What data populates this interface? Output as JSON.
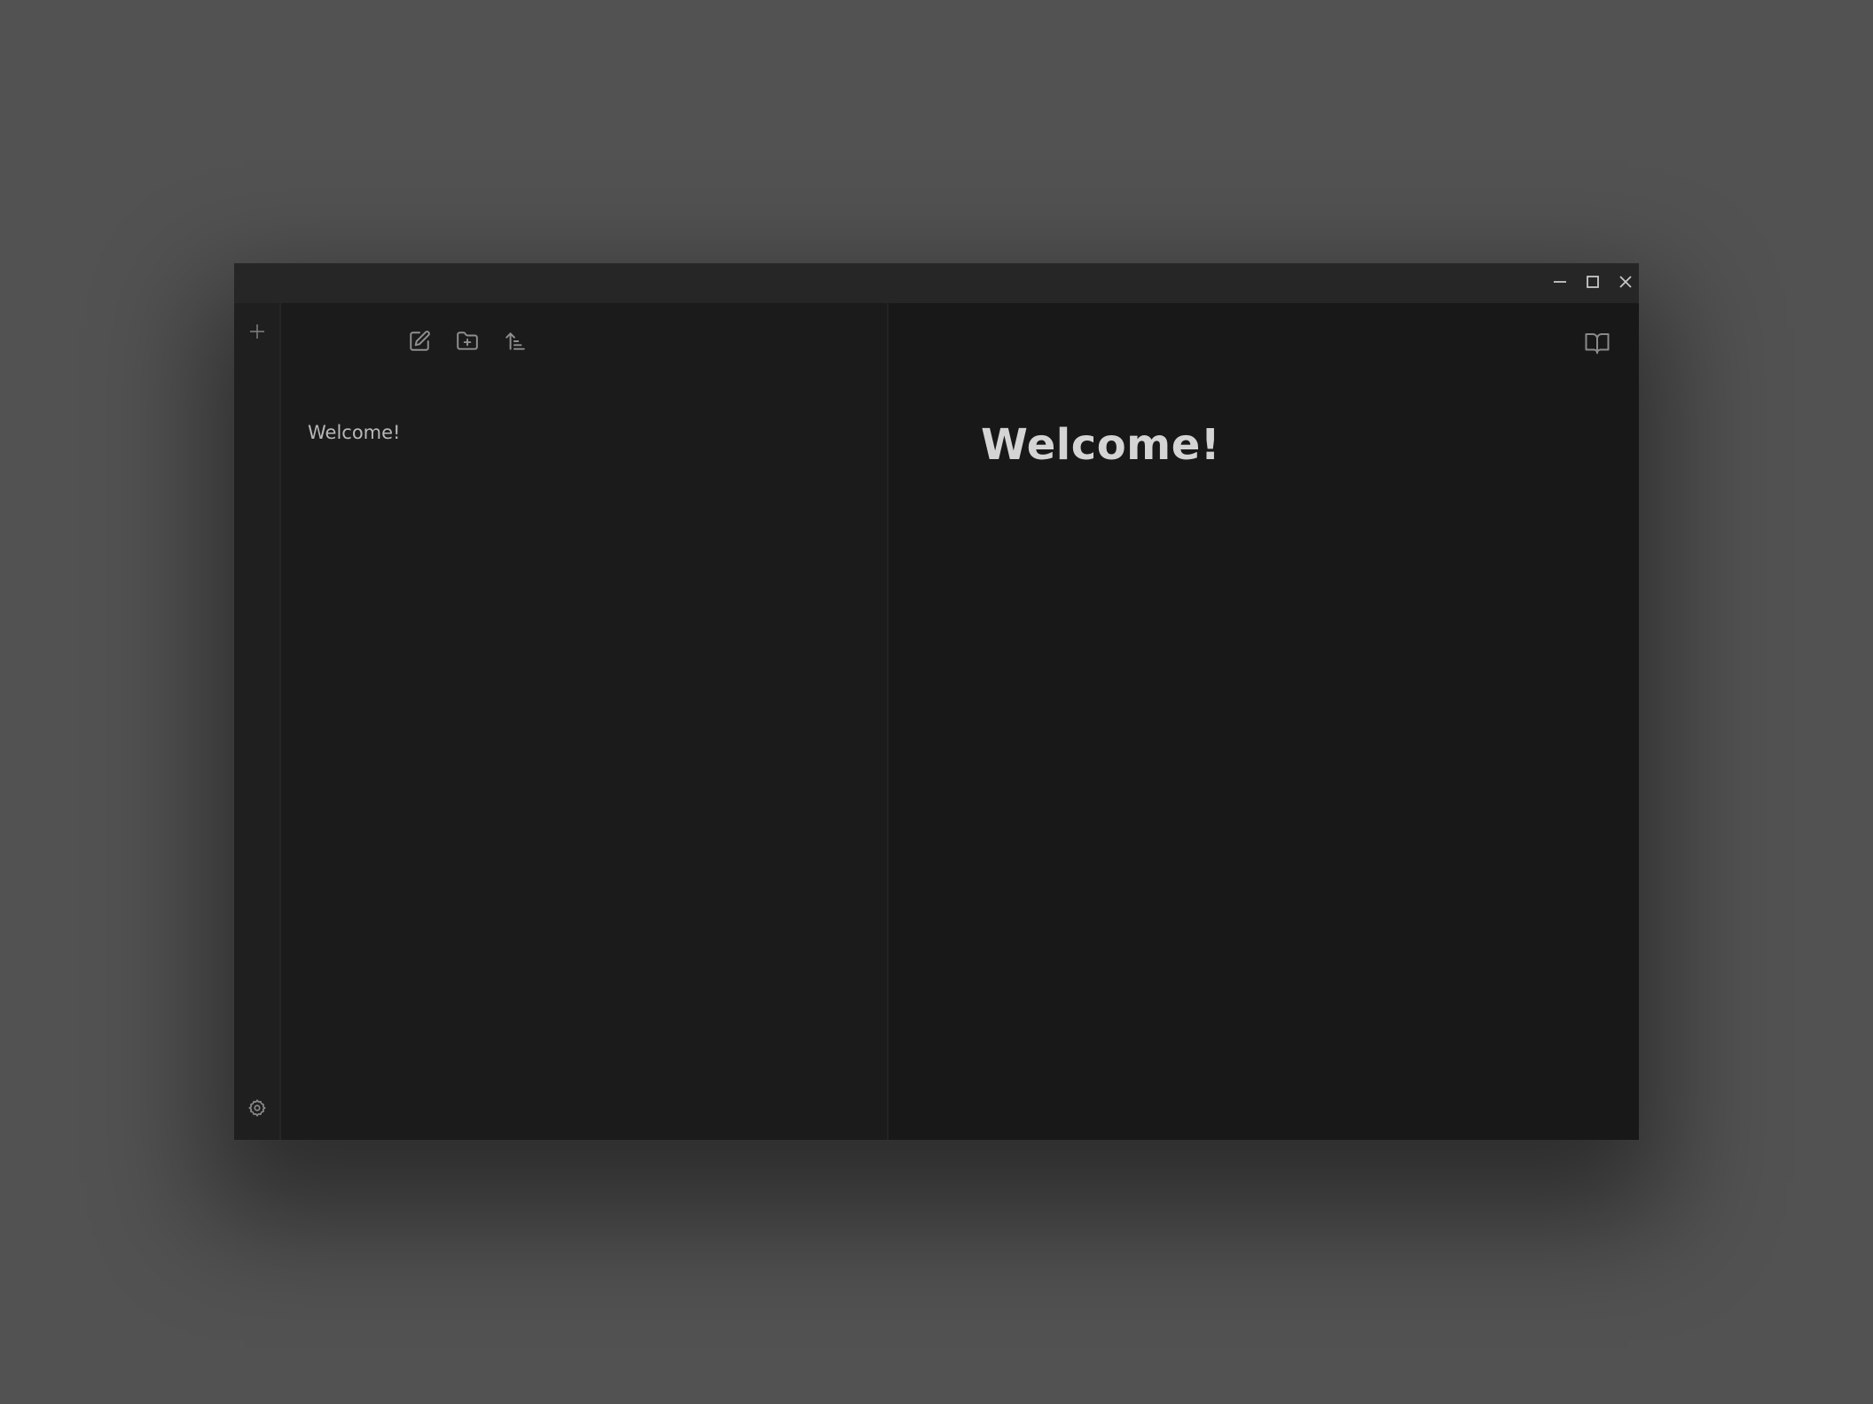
{
  "window": {
    "controls": {
      "minimize_icon": "minimize-icon",
      "maximize_icon": "maximize-icon",
      "close_icon": "close-icon"
    }
  },
  "ribbon": {
    "top_icon": "plus-icon",
    "bottom_icon": "gear-icon"
  },
  "sidebar": {
    "toolbar": [
      {
        "icon": "new-note-icon"
      },
      {
        "icon": "new-folder-icon"
      },
      {
        "icon": "sort-icon"
      }
    ],
    "files": [
      {
        "label": "Welcome!"
      }
    ]
  },
  "main": {
    "reading_mode_icon": "book-open-icon",
    "title": "Welcome!"
  },
  "colors": {
    "desktop": "#525252",
    "titlebar": "#262626",
    "sidebar": "#1b1b1b",
    "editor": "#181818",
    "icon": "#8a8a8a",
    "text": "#b8b8b8",
    "heading": "#d4d4d4"
  }
}
